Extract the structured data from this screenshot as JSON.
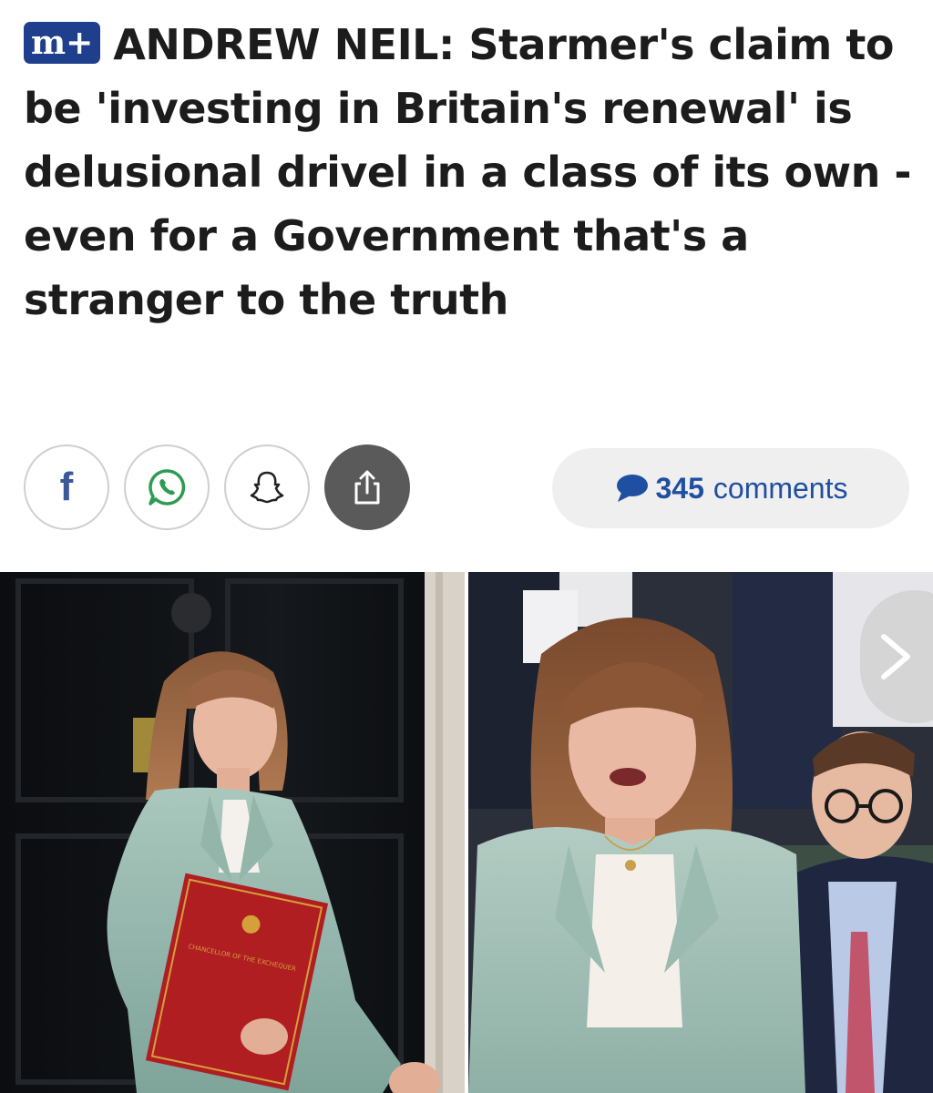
{
  "article": {
    "badge": "m+",
    "headline": "ANDREW NEIL: Starmer's claim to be 'investing in Britain's renewal' is delusional drivel in a class of its own - even for a Government that's a stranger to the truth"
  },
  "share": {
    "buttons": [
      {
        "name": "facebook",
        "icon": "facebook-icon"
      },
      {
        "name": "whatsapp",
        "icon": "whatsapp-icon"
      },
      {
        "name": "snapchat",
        "icon": "snapchat-icon"
      },
      {
        "name": "share",
        "icon": "share-upload-icon"
      }
    ]
  },
  "comments": {
    "count": "345",
    "label": "comments"
  },
  "gallery": {
    "folder_text": "CHANCELLOR OF THE EXCHEQUER",
    "next_icon": "chevron-right-icon"
  },
  "colors": {
    "badge": "#1f3f8c",
    "comments_text": "#1f4fa0",
    "facebook": "#3b5998",
    "headline": "#1c1c1c"
  }
}
